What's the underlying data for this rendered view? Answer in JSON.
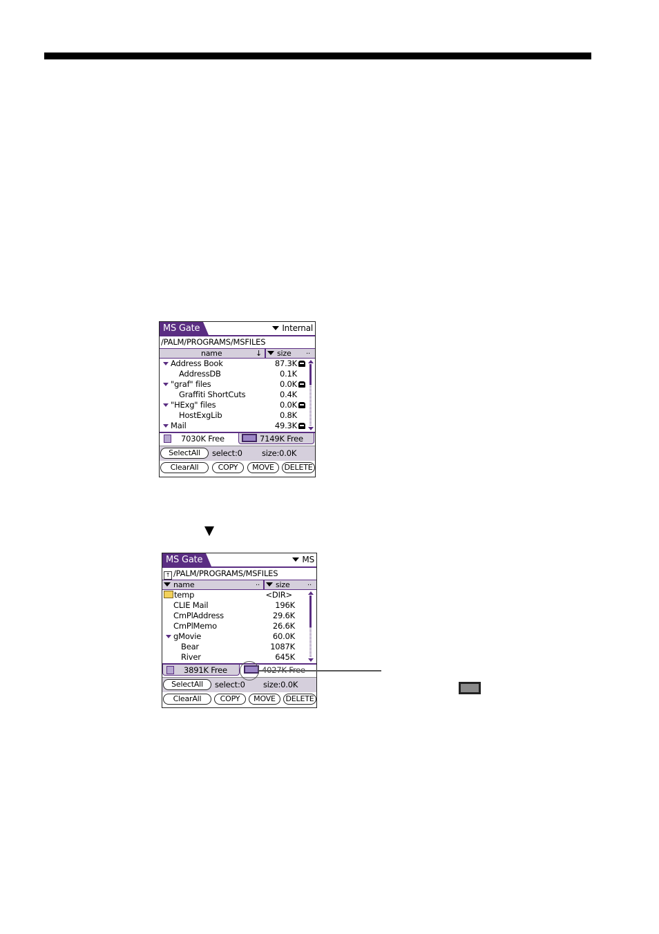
{
  "screen1": {
    "app_title": "MS Gate",
    "drive_label": "Internal",
    "path": "/PALM/PROGRAMS/MSFILES",
    "columns": {
      "name": "name",
      "name_sort": "↓",
      "size": "size",
      "more": ".."
    },
    "rows": [
      {
        "name": "Address Book",
        "size": "87.3K",
        "expandable": true,
        "locked": true
      },
      {
        "name": "AddressDB",
        "size": "0.1K",
        "expandable": false,
        "locked": false
      },
      {
        "name": "\"graf\" files",
        "size": "0.0K",
        "expandable": true,
        "locked": true
      },
      {
        "name": "Graffiti ShortCuts",
        "size": "0.4K",
        "expandable": false,
        "locked": false
      },
      {
        "name": "\"HExg\" files",
        "size": "0.0K",
        "expandable": true,
        "locked": true
      },
      {
        "name": "HostExgLib",
        "size": "0.8K",
        "expandable": false,
        "locked": false
      },
      {
        "name": "Mail",
        "size": "49.3K",
        "expandable": true,
        "locked": true
      }
    ],
    "free_internal": "7030K Free",
    "free_ms": "7149K Free",
    "buttons": {
      "select_all": "SelectAll",
      "clear_all": "ClearAll",
      "copy": "COPY",
      "move": "MOVE",
      "delete": "DELETE"
    },
    "status": {
      "select": "select:0",
      "size": "size:0.0K"
    }
  },
  "arrow_glyph": "▼",
  "screen2": {
    "app_title": "MS Gate",
    "drive_label": "MS",
    "path": "/PALM/PROGRAMS/MSFILES",
    "columns": {
      "name": "name",
      "size": "size",
      "more": ".."
    },
    "rows": [
      {
        "name": "temp",
        "size": "<DIR>",
        "folder": true
      },
      {
        "name": "CLIE Mail",
        "size": "196K"
      },
      {
        "name": "CmPlAddress",
        "size": "29.6K"
      },
      {
        "name": "CmPlMemo",
        "size": "26.6K"
      },
      {
        "name": "gMovie",
        "size": "60.0K",
        "expandable": true
      },
      {
        "name": "Bear",
        "size": "1087K"
      },
      {
        "name": "River",
        "size": "645K"
      }
    ],
    "free_internal": "3891K Free",
    "free_ms": "4027K Free",
    "buttons": {
      "select_all": "SelectAll",
      "clear_all": "ClearAll",
      "copy": "COPY",
      "move": "MOVE",
      "delete": "DELETE"
    },
    "status": {
      "select": "select:0",
      "size": "size:0.0K"
    }
  },
  "colors": {
    "accent": "#5a2d82",
    "header_bg": "#d5cfdc"
  }
}
